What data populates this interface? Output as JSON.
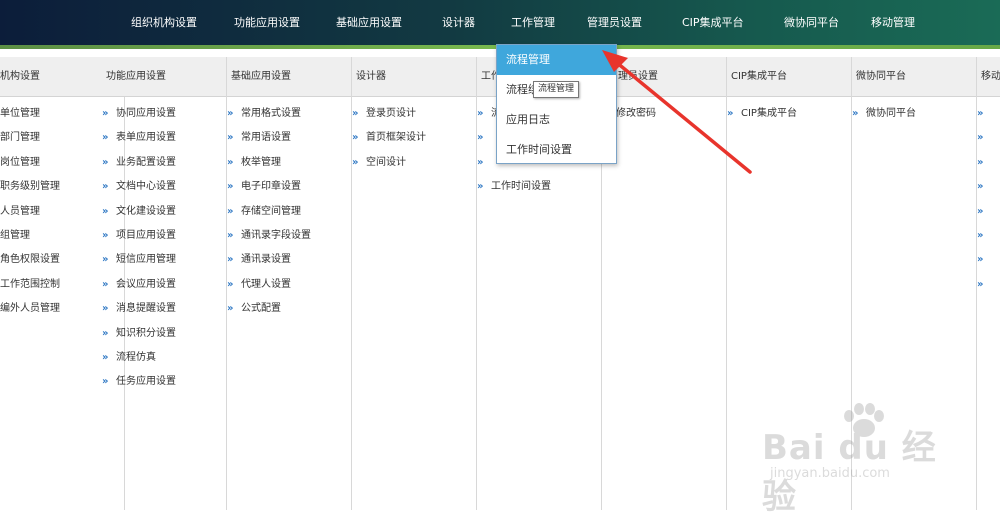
{
  "topnav": {
    "items": [
      "组织机构设置",
      "功能应用设置",
      "基础应用设置",
      "设计器",
      "工作管理",
      "管理员设置",
      "CIP集成平台",
      "微协同平台",
      "移动管理"
    ]
  },
  "columns": [
    {
      "header": "机构设置",
      "items": [
        "单位管理",
        "部门管理",
        "岗位管理",
        "职务级别管理",
        "人员管理",
        "组管理",
        "角色权限设置",
        "工作范围控制",
        "编外人员管理"
      ]
    },
    {
      "header": "功能应用设置",
      "items": [
        "协同应用设置",
        "表单应用设置",
        "业务配置设置",
        "文档中心设置",
        "文化建设设置",
        "项目应用设置",
        "短信应用管理",
        "会议应用设置",
        "消息提醒设置",
        "知识积分设置",
        "流程仿真",
        "任务应用设置"
      ]
    },
    {
      "header": "基础应用设置",
      "items": [
        "常用格式设置",
        "常用语设置",
        "枚举管理",
        "电子印章设置",
        "存储空间管理",
        "通讯录字段设置",
        "通讯录设置",
        "代理人设置",
        "公式配置"
      ]
    },
    {
      "header": "设计器",
      "items": [
        "登录页设计",
        "首页框架设计",
        "空间设计"
      ]
    },
    {
      "header": "工作",
      "items": [
        "流程",
        "",
        "",
        "工作时间设置"
      ]
    },
    {
      "header": "理员设置",
      "items": [
        "修改密码"
      ]
    },
    {
      "header": "CIP集成平台",
      "items": [
        "CIP集成平台"
      ]
    },
    {
      "header": "微协同平台",
      "items": [
        "微协同平台"
      ]
    },
    {
      "header": "移动",
      "items": [
        "",
        "",
        "",
        "",
        "",
        "",
        "",
        ""
      ]
    }
  ],
  "dropdown": {
    "items": [
      "流程管理",
      "流程绑",
      "应用日志",
      "工作时间设置"
    ],
    "active_index": 0
  },
  "tooltip": "流程管理",
  "watermark": {
    "line1": "Bai du 经验",
    "line2": "jingyan.baidu.com"
  },
  "colors": {
    "accent": "#3fa7dc",
    "arrow": "#e8342c",
    "bullet": "#2f78c4"
  },
  "icons": {
    "bullet": "double-chevron-right-icon",
    "annotation": "red-arrow-icon",
    "watermark": "baidu-paw-icon"
  }
}
